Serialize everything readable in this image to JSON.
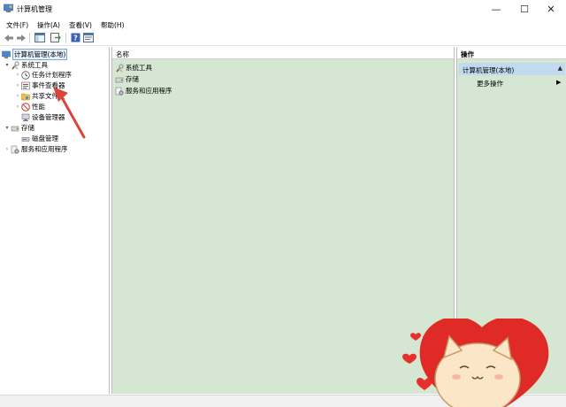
{
  "window": {
    "title": "计算机管理",
    "controls": {
      "minimize": "—",
      "maximize": "☐",
      "close": "✕"
    }
  },
  "menu": [
    "文件(F)",
    "操作(A)",
    "查看(V)",
    "帮助(H)"
  ],
  "tree": {
    "root": "计算机管理(本地)",
    "system_tools": "系统工具",
    "task_scheduler": "任务计划程序",
    "event_viewer": "事件查看器",
    "shared_folders": "共享文件夹",
    "performance": "性能",
    "device_manager": "设备管理器",
    "storage": "存储",
    "disk_management": "磁盘管理",
    "services_apps": "服务和应用程序"
  },
  "list": {
    "column_name": "名称",
    "items": [
      "系统工具",
      "存储",
      "服务和应用程序"
    ]
  },
  "actions": {
    "title": "操作",
    "group": "计算机管理(本地)",
    "more": "更多操作"
  },
  "icons": [
    "back-icon",
    "forward-icon",
    "console-tree-icon",
    "export-icon",
    "help-icon",
    "properties-icon"
  ],
  "colors": {
    "pane_bg": "#d5e7d3",
    "selected_bg": "#c2daf0",
    "annotation": "#d9453a"
  }
}
